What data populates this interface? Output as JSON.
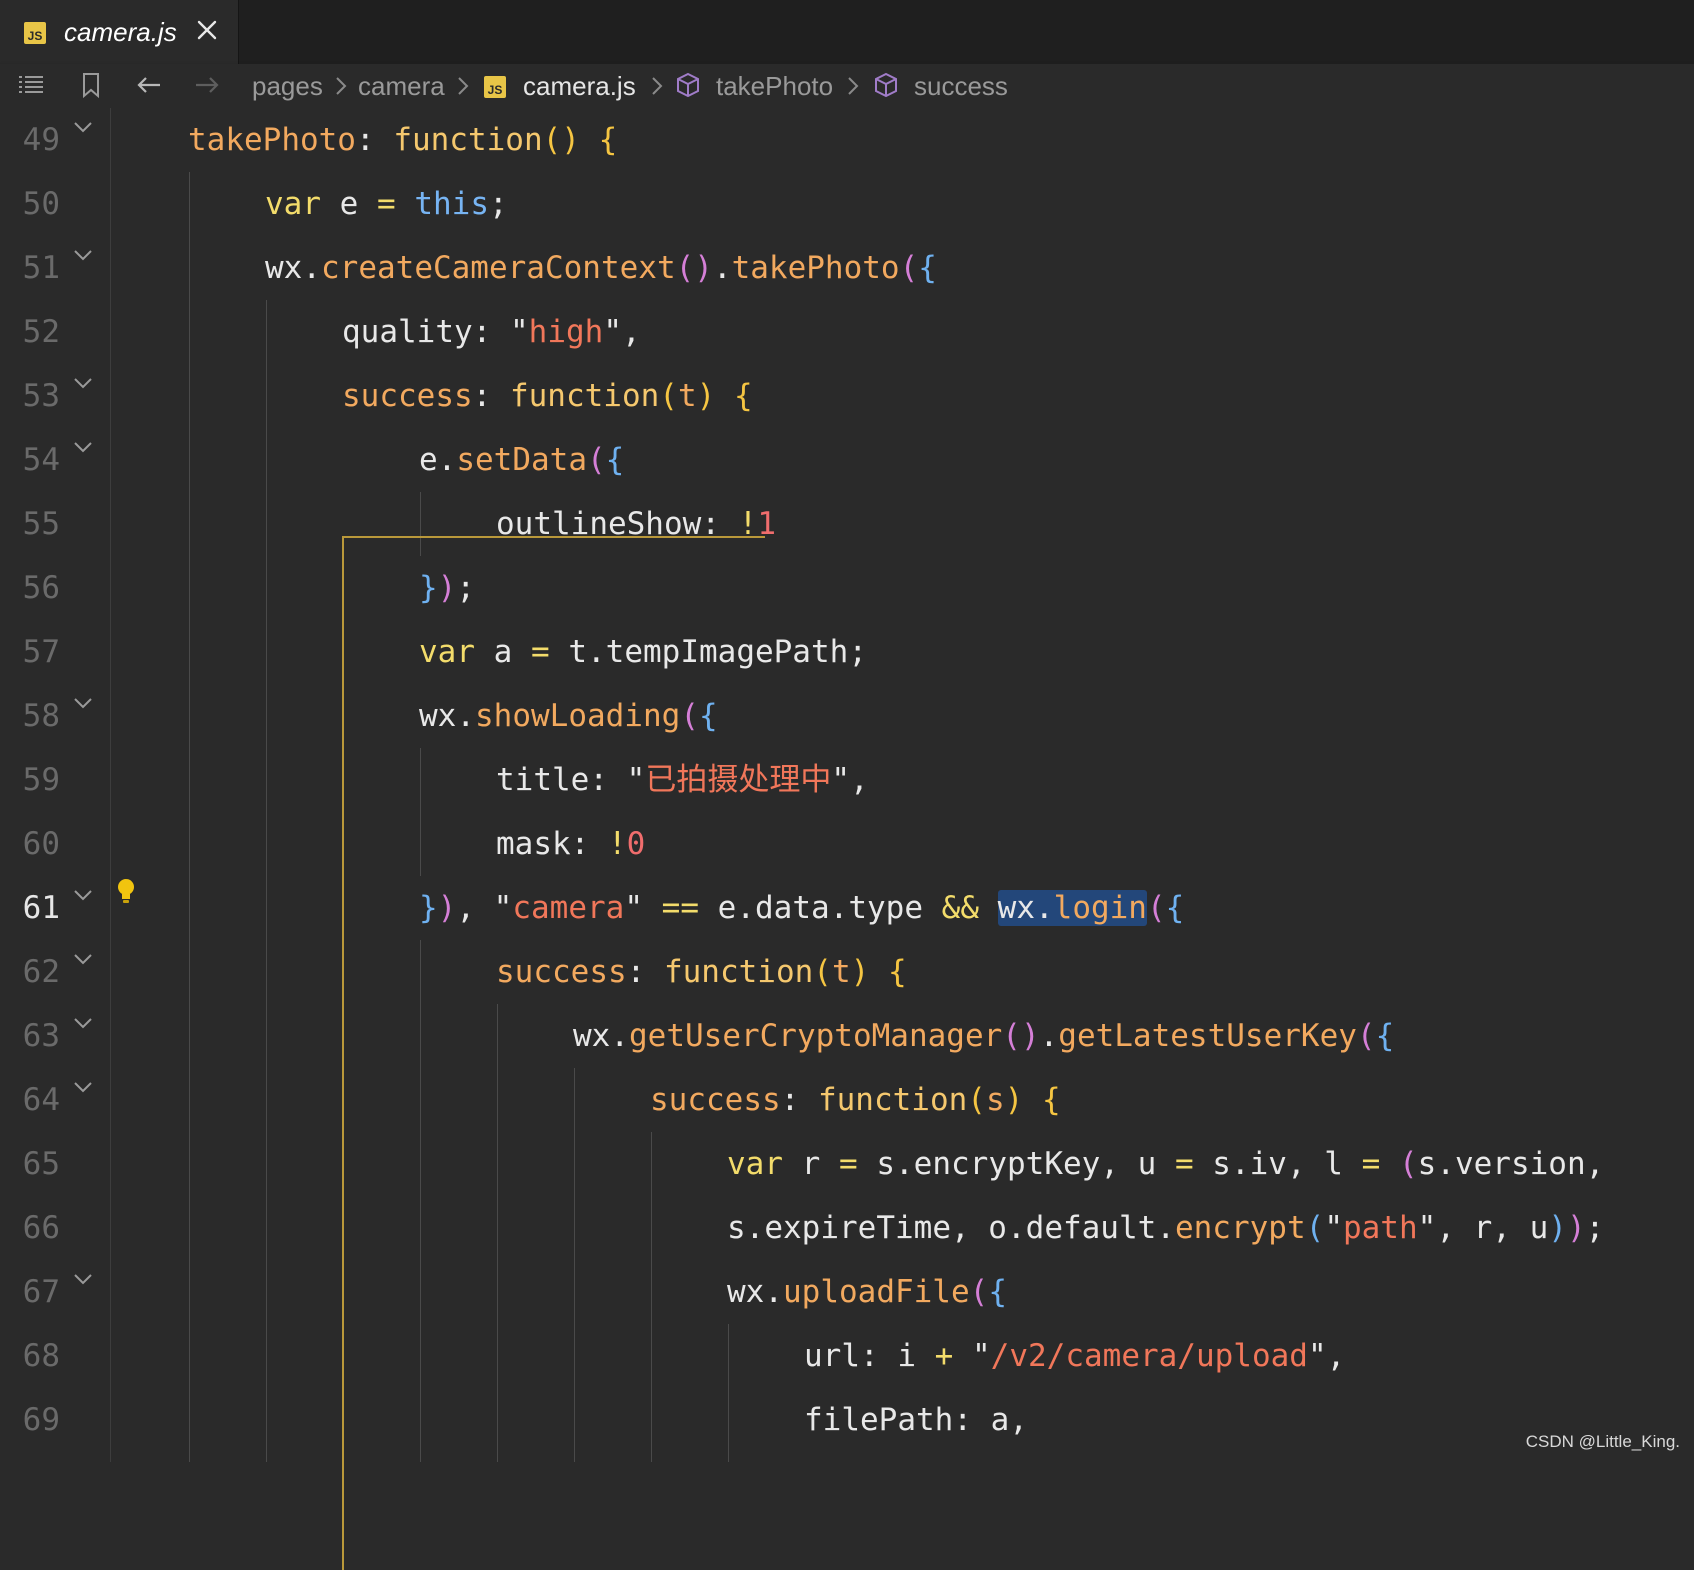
{
  "tab": {
    "badge": "JS",
    "filename": "camera.js"
  },
  "breadcrumb": {
    "items": [
      {
        "label": "pages"
      },
      {
        "label": "camera"
      },
      {
        "badge": "JS",
        "label": "camera.js"
      },
      {
        "label": "takePhoto"
      },
      {
        "label": "success"
      }
    ]
  },
  "editor": {
    "active_line": "61",
    "lines": [
      {
        "n": "49",
        "fold": true
      },
      {
        "n": "50",
        "fold": false
      },
      {
        "n": "51",
        "fold": true
      },
      {
        "n": "52",
        "fold": false
      },
      {
        "n": "53",
        "fold": true
      },
      {
        "n": "54",
        "fold": true
      },
      {
        "n": "55",
        "fold": false
      },
      {
        "n": "56",
        "fold": false
      },
      {
        "n": "57",
        "fold": false
      },
      {
        "n": "58",
        "fold": true
      },
      {
        "n": "59",
        "fold": false
      },
      {
        "n": "60",
        "fold": false
      },
      {
        "n": "61",
        "fold": true
      },
      {
        "n": "62",
        "fold": true
      },
      {
        "n": "63",
        "fold": true
      },
      {
        "n": "64",
        "fold": true
      },
      {
        "n": "65",
        "fold": false
      },
      {
        "n": "66",
        "fold": false
      },
      {
        "n": "67",
        "fold": true
      },
      {
        "n": "68",
        "fold": false
      },
      {
        "n": "69",
        "fold": false
      }
    ],
    "code": [
      [
        [
          "takePhoto",
          "key"
        ],
        [
          ": ",
          "pun"
        ],
        [
          "function",
          "fn"
        ],
        [
          "()",
          "b1"
        ],
        [
          " ",
          "pun"
        ],
        [
          "{",
          "b1"
        ]
      ],
      [
        [
          "var",
          "kw"
        ],
        [
          " e ",
          "plain"
        ],
        [
          "=",
          "op"
        ],
        [
          " ",
          "pun"
        ],
        [
          "this",
          "this"
        ],
        [
          ";",
          "pun"
        ]
      ],
      [
        [
          "wx",
          "plain"
        ],
        [
          ".",
          "pun"
        ],
        [
          "createCameraContext",
          "key"
        ],
        [
          "()",
          "b2"
        ],
        [
          ".",
          "pun"
        ],
        [
          "takePhoto",
          "key"
        ],
        [
          "(",
          "b2"
        ],
        [
          "{",
          "b3"
        ]
      ],
      [
        [
          "quality",
          "plain"
        ],
        [
          ": ",
          "pun"
        ],
        [
          "\"",
          "pun"
        ],
        [
          "high",
          "str"
        ],
        [
          "\"",
          "pun"
        ],
        [
          ",",
          "pun"
        ]
      ],
      [
        [
          "success",
          "key"
        ],
        [
          ": ",
          "pun"
        ],
        [
          "function",
          "fn"
        ],
        [
          "(",
          "b1"
        ],
        [
          "t",
          "key"
        ],
        [
          ")",
          "b1"
        ],
        [
          " ",
          "pun"
        ],
        [
          "{",
          "b1"
        ]
      ],
      [
        [
          "e",
          "plain"
        ],
        [
          ".",
          "pun"
        ],
        [
          "setData",
          "key"
        ],
        [
          "(",
          "b2"
        ],
        [
          "{",
          "b3"
        ]
      ],
      [
        [
          "outlineShow",
          "plain"
        ],
        [
          ": ",
          "pun"
        ],
        [
          "!",
          "op"
        ],
        [
          "1",
          "num"
        ]
      ],
      [
        [
          "}",
          "b3"
        ],
        [
          ")",
          "b2"
        ],
        [
          ";",
          "pun"
        ]
      ],
      [
        [
          "var",
          "kw"
        ],
        [
          " a ",
          "plain"
        ],
        [
          "=",
          "op"
        ],
        [
          " t",
          "plain"
        ],
        [
          ".",
          "pun"
        ],
        [
          "tempImagePath",
          "plain"
        ],
        [
          ";",
          "pun"
        ]
      ],
      [
        [
          "wx",
          "plain"
        ],
        [
          ".",
          "pun"
        ],
        [
          "showLoading",
          "key"
        ],
        [
          "(",
          "b2"
        ],
        [
          "{",
          "b3"
        ]
      ],
      [
        [
          "title",
          "plain"
        ],
        [
          ": ",
          "pun"
        ],
        [
          "\"",
          "pun"
        ],
        [
          "已拍摄处理中",
          "str"
        ],
        [
          "\"",
          "pun"
        ],
        [
          ",",
          "pun"
        ]
      ],
      [
        [
          "mask",
          "plain"
        ],
        [
          ": ",
          "pun"
        ],
        [
          "!",
          "op"
        ],
        [
          "0",
          "num"
        ]
      ],
      [
        [
          "}",
          "b3"
        ],
        [
          ")",
          "b2"
        ],
        [
          ", ",
          "pun"
        ],
        [
          "\"",
          "pun"
        ],
        [
          "camera",
          "str"
        ],
        [
          "\"",
          "pun"
        ],
        [
          " ",
          "pun"
        ],
        [
          "==",
          "op"
        ],
        [
          " e",
          "plain"
        ],
        [
          ".",
          "pun"
        ],
        [
          "data",
          "plain"
        ],
        [
          ".",
          "pun"
        ],
        [
          "type ",
          "plain"
        ],
        [
          "&&",
          "op"
        ],
        [
          " ",
          "pun"
        ],
        [
          "wx.login",
          "hl"
        ],
        [
          "(",
          "b2"
        ],
        [
          "{",
          "b3"
        ]
      ],
      [
        [
          "success",
          "key"
        ],
        [
          ": ",
          "pun"
        ],
        [
          "function",
          "fn"
        ],
        [
          "(",
          "b1"
        ],
        [
          "t",
          "key"
        ],
        [
          ")",
          "b1"
        ],
        [
          " ",
          "pun"
        ],
        [
          "{",
          "b1"
        ]
      ],
      [
        [
          "wx",
          "plain"
        ],
        [
          ".",
          "pun"
        ],
        [
          "getUserCryptoManager",
          "key"
        ],
        [
          "()",
          "b2"
        ],
        [
          ".",
          "pun"
        ],
        [
          "getLatestUserKey",
          "key"
        ],
        [
          "(",
          "b2"
        ],
        [
          "{",
          "b3"
        ]
      ],
      [
        [
          "success",
          "key"
        ],
        [
          ": ",
          "pun"
        ],
        [
          "function",
          "fn"
        ],
        [
          "(",
          "b1"
        ],
        [
          "s",
          "key"
        ],
        [
          ")",
          "b1"
        ],
        [
          " ",
          "pun"
        ],
        [
          "{",
          "b1"
        ]
      ],
      [
        [
          "var",
          "kw"
        ],
        [
          " r ",
          "plain"
        ],
        [
          "=",
          "op"
        ],
        [
          " s",
          "plain"
        ],
        [
          ".",
          "pun"
        ],
        [
          "encryptKey",
          "plain"
        ],
        [
          ", u ",
          "plain"
        ],
        [
          "=",
          "op"
        ],
        [
          " s",
          "plain"
        ],
        [
          ".",
          "pun"
        ],
        [
          "iv",
          "plain"
        ],
        [
          ", l ",
          "plain"
        ],
        [
          "=",
          "op"
        ],
        [
          " ",
          "pun"
        ],
        [
          "(",
          "b2"
        ],
        [
          "s",
          "plain"
        ],
        [
          ".",
          "pun"
        ],
        [
          "version",
          "plain"
        ],
        [
          ",",
          "pun"
        ]
      ],
      [
        [
          "s",
          "plain"
        ],
        [
          ".",
          "pun"
        ],
        [
          "expireTime",
          "plain"
        ],
        [
          ", o",
          "plain"
        ],
        [
          ".",
          "pun"
        ],
        [
          "default",
          "plain"
        ],
        [
          ".",
          "pun"
        ],
        [
          "encrypt",
          "key"
        ],
        [
          "(",
          "b3"
        ],
        [
          "\"",
          "pun"
        ],
        [
          "path",
          "str"
        ],
        [
          "\"",
          "pun"
        ],
        [
          ", r, u",
          "plain"
        ],
        [
          ")",
          "b3"
        ],
        [
          ")",
          "b2"
        ],
        [
          ";",
          "pun"
        ]
      ],
      [
        [
          "wx",
          "plain"
        ],
        [
          ".",
          "pun"
        ],
        [
          "uploadFile",
          "key"
        ],
        [
          "(",
          "b2"
        ],
        [
          "{",
          "b3"
        ]
      ],
      [
        [
          "url",
          "plain"
        ],
        [
          ": i ",
          "plain"
        ],
        [
          "+",
          "op"
        ],
        [
          " ",
          "pun"
        ],
        [
          "\"",
          "pun"
        ],
        [
          "/v2/camera/upload",
          "str"
        ],
        [
          "\"",
          "pun"
        ],
        [
          ",",
          "pun"
        ]
      ],
      [
        [
          "filePath",
          "plain"
        ],
        [
          ": a,",
          "plain"
        ]
      ]
    ]
  },
  "watermark": "CSDN @Little_King."
}
